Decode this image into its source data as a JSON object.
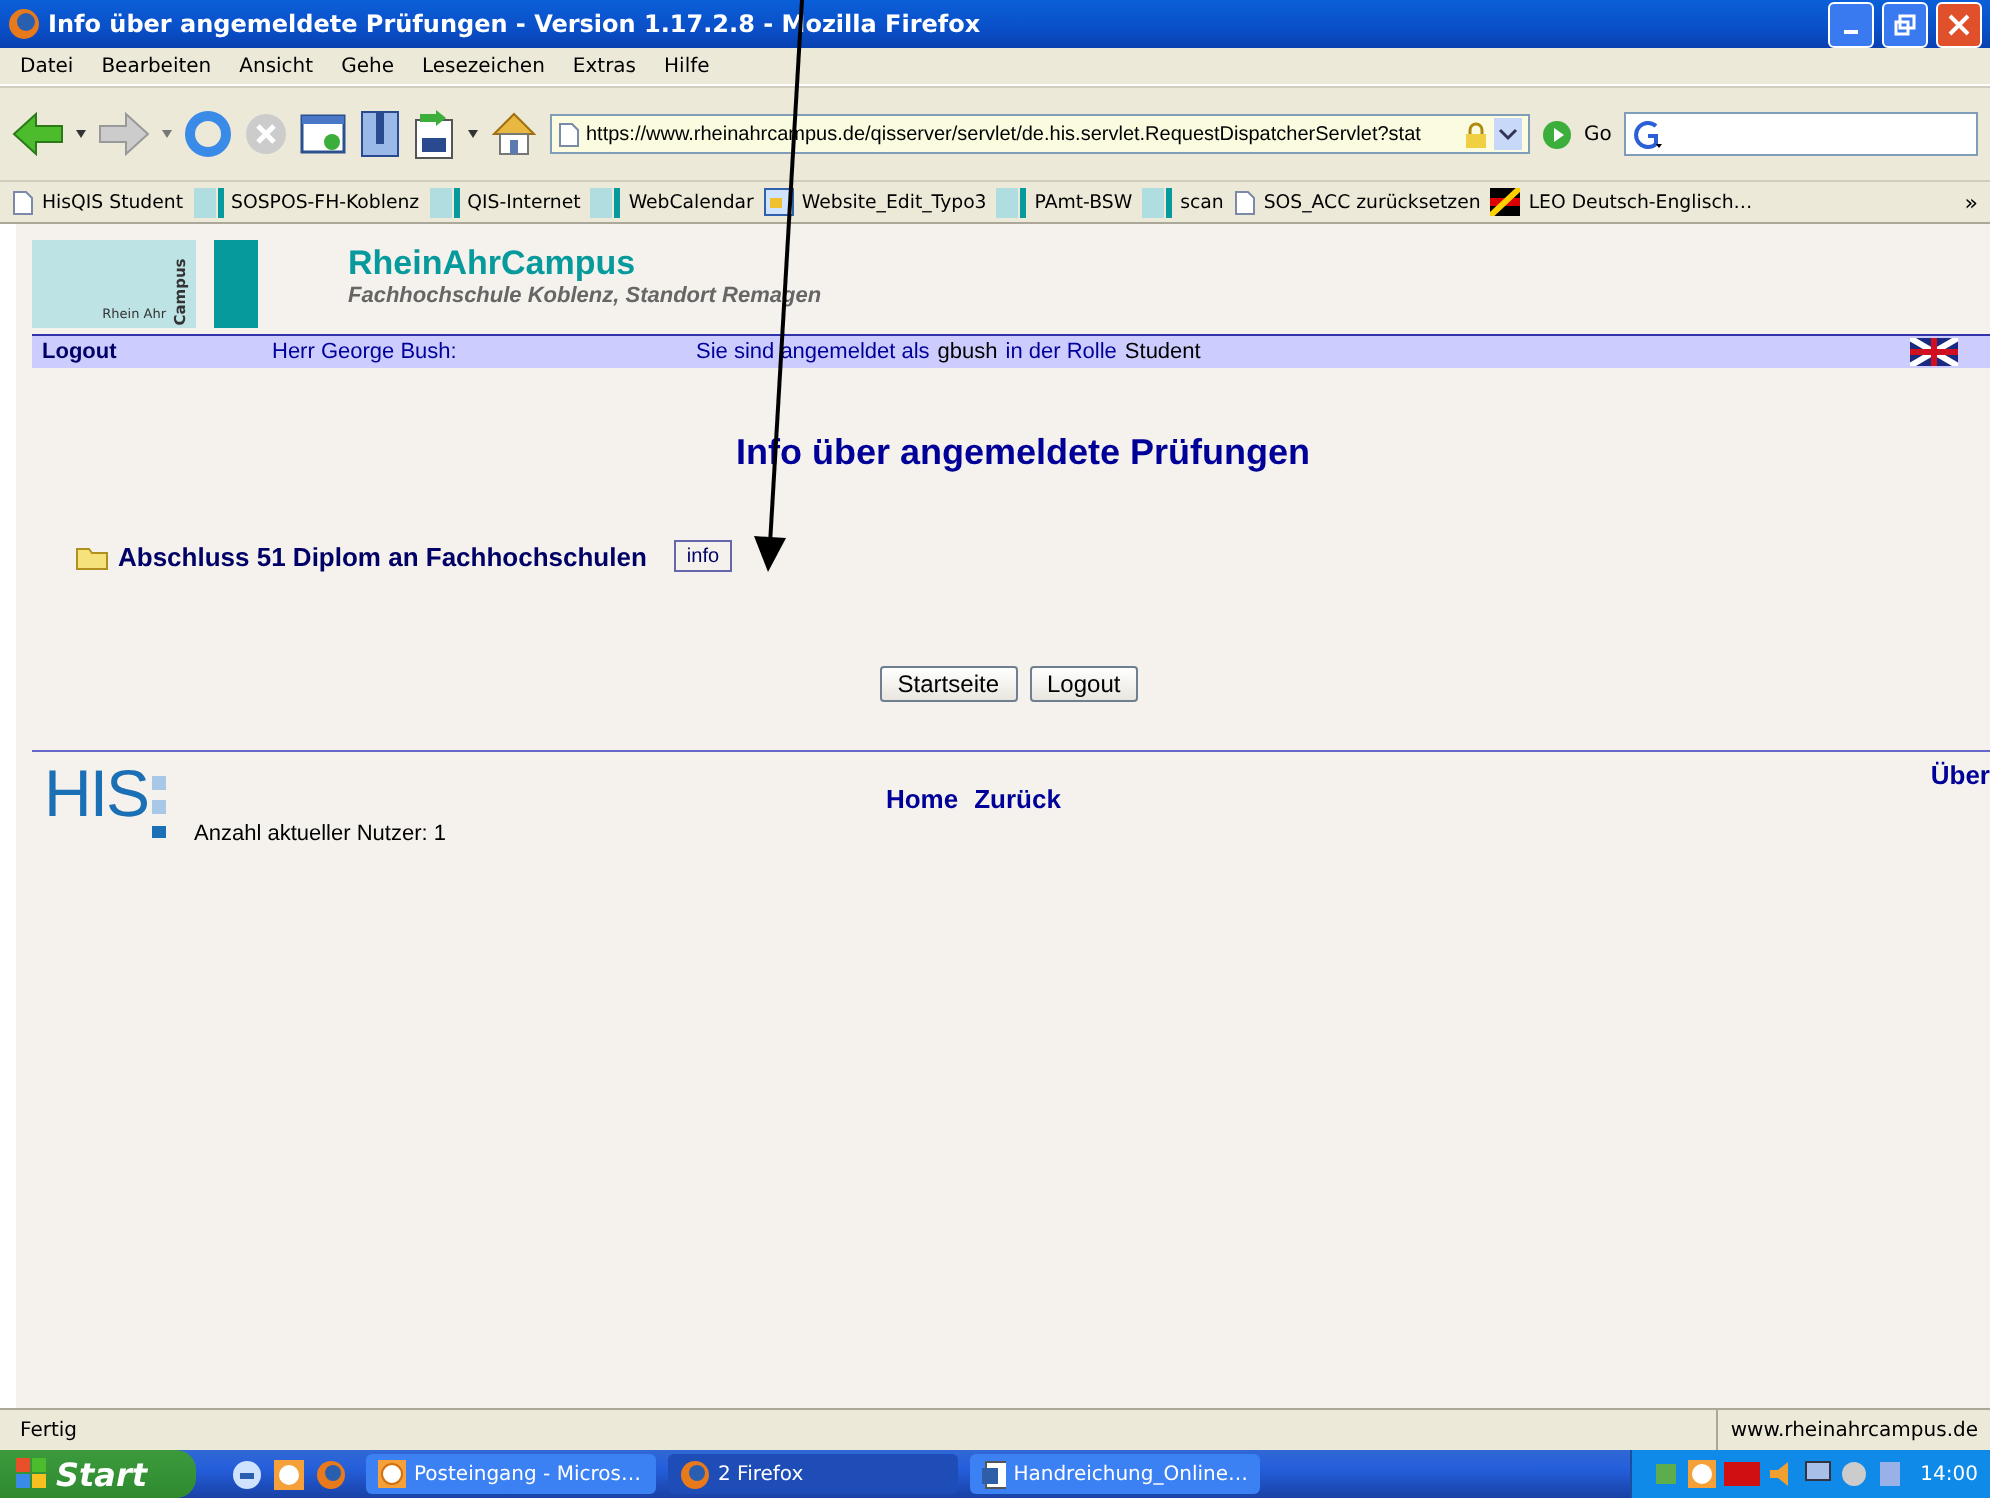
{
  "window": {
    "title": "Info über angemeldete Prüfungen - Version 1.17.2.8 - Mozilla Firefox"
  },
  "menu": [
    "Datei",
    "Bearbeiten",
    "Ansicht",
    "Gehe",
    "Lesezeichen",
    "Extras",
    "Hilfe"
  ],
  "toolbar": {
    "url": "https://www.rheinahrcampus.de/qisserver/servlet/de.his.servlet.RequestDispatcherServlet?stat",
    "go": "Go"
  },
  "bookmarks": [
    {
      "label": "HisQIS Student",
      "kind": "page"
    },
    {
      "label": "SOSPOS-FH-Koblenz",
      "kind": "site"
    },
    {
      "label": "QIS-Internet",
      "kind": "site"
    },
    {
      "label": "WebCalendar",
      "kind": "site"
    },
    {
      "label": "Website_Edit_Typo3",
      "kind": "web"
    },
    {
      "label": "PAmt-BSW",
      "kind": "site"
    },
    {
      "label": "scan",
      "kind": "site"
    },
    {
      "label": "SOS_ACC zurücksetzen",
      "kind": "page"
    },
    {
      "label": "LEO Deutsch-Englisch…",
      "kind": "flag"
    }
  ],
  "bookmarks_overflow": "»",
  "page": {
    "logo": {
      "line1": "Rhein Ahr",
      "line2": "Campus"
    },
    "site_title": "RheinAhrCampus",
    "site_subtitle": "Fachhochschule Koblenz, Standort Remagen",
    "userbar": {
      "logout": "Logout",
      "user": "Herr George Bush:",
      "status": [
        {
          "text": "Sie sind angemeldet als",
          "kind": "label"
        },
        {
          "text": "gbush",
          "kind": "value"
        },
        {
          "text": "in der Rolle",
          "kind": "label"
        },
        {
          "text": "Student",
          "kind": "value"
        }
      ]
    },
    "heading": "Info über angemeldete Prüfungen",
    "degrees": [
      {
        "label": "Abschluss 51 Diplom an Fachhochschulen",
        "button": "info"
      }
    ],
    "buttons": [
      "Startseite",
      "Logout"
    ],
    "footer": {
      "logo": "HIS",
      "users": "Anzahl aktueller Nutzer: 1",
      "links": [
        "Home",
        "Zurück"
      ],
      "right": "Über"
    }
  },
  "status_bar": {
    "text": "Fertig",
    "host": "www.rheinahrcampus.de"
  },
  "taskbar": {
    "start": "Start",
    "tasks": [
      {
        "label": "Posteingang - Micros…",
        "kind": "mail",
        "selected": false
      },
      {
        "label": "2 Firefox",
        "kind": "firefox",
        "selected": true
      },
      {
        "label": "Handreichung_Online…",
        "kind": "word",
        "selected": false
      }
    ],
    "clock": "14:00"
  }
}
